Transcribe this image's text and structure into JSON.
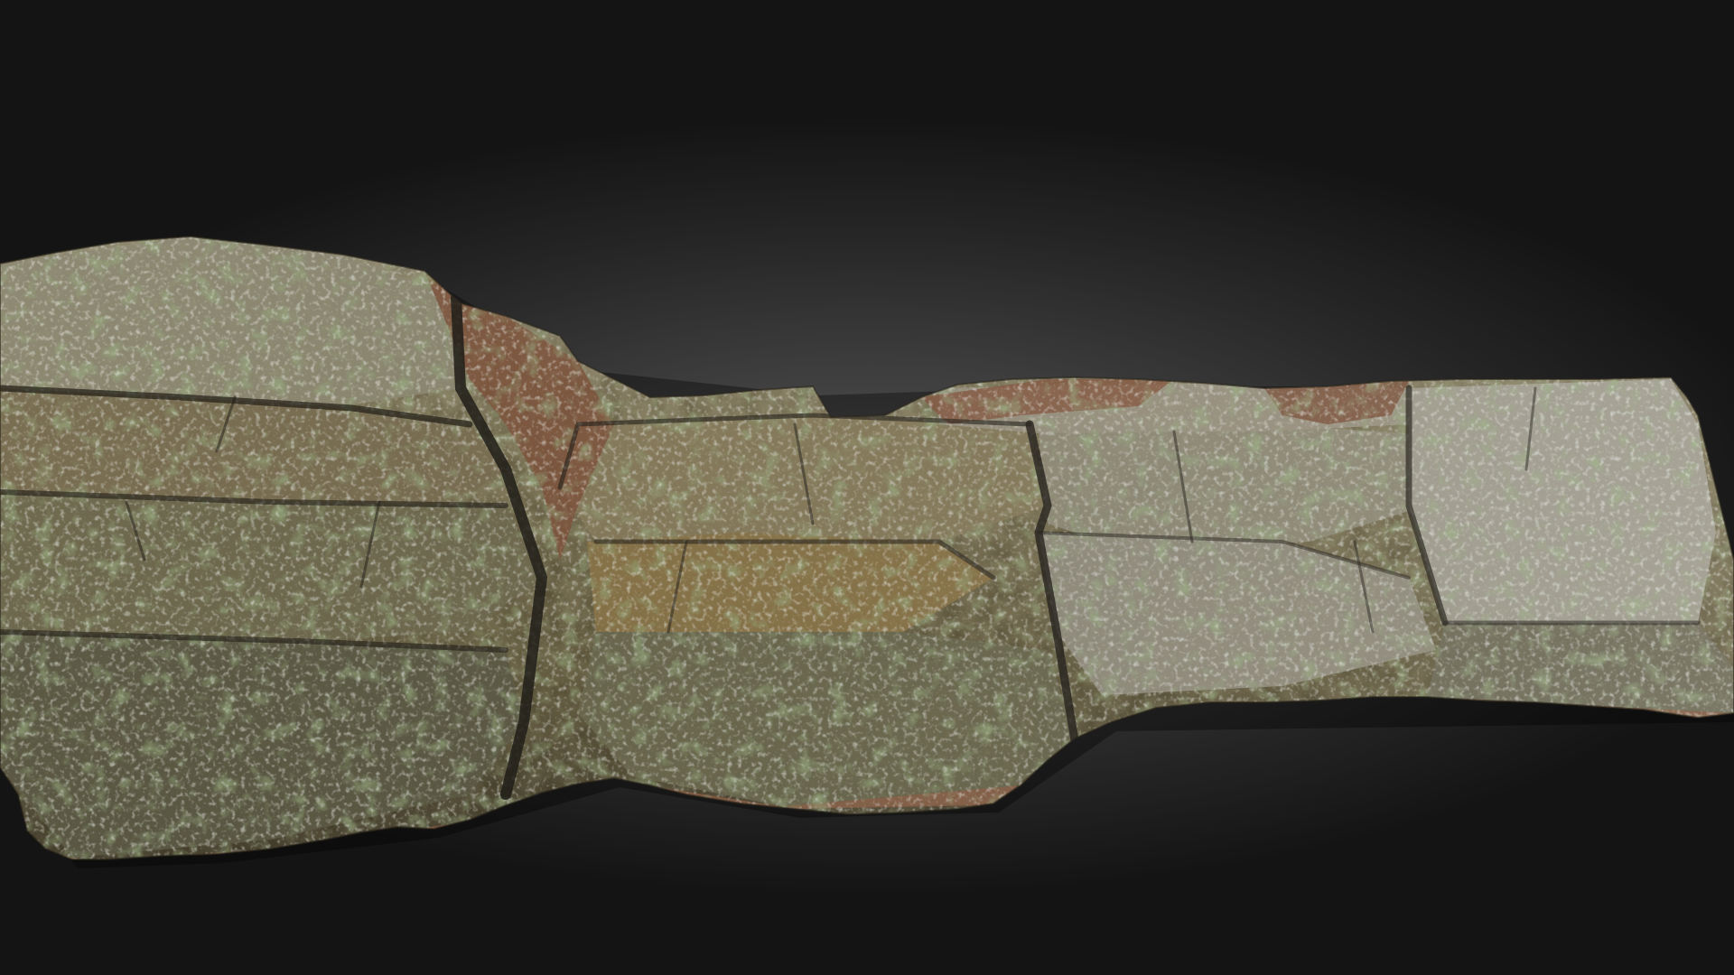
{
  "scene": {
    "subject_icon": "rock-outcrop-icon",
    "colors": {
      "background_center": "#555555",
      "background_edge": "#141414",
      "rock_base": "#7d7458",
      "rock_dark": "#3d3a2b",
      "rock_light": "#b5b2a4",
      "lichen": "#c9cdc2",
      "moss": "#56673a",
      "needles": "#8a5a3e",
      "crack": "#1f1c16"
    }
  }
}
